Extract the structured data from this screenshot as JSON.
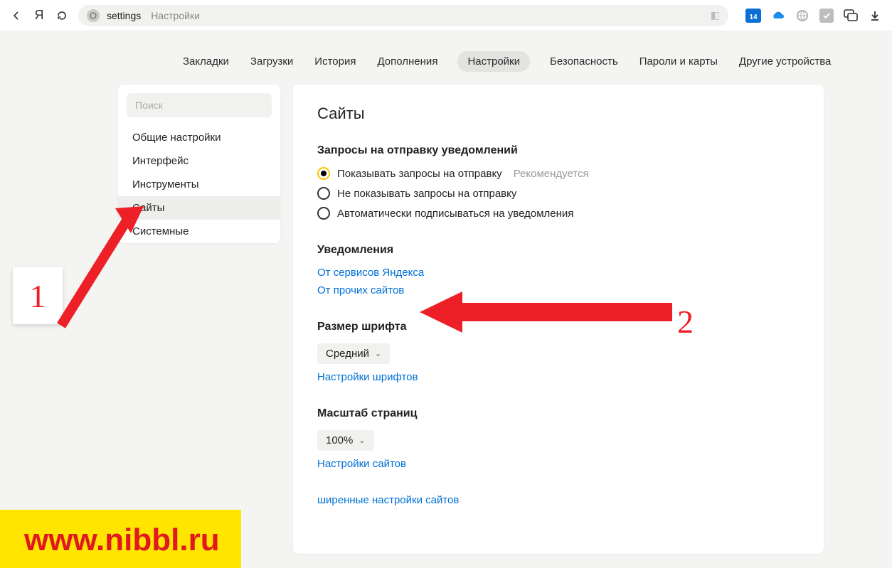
{
  "toolbar": {
    "url_prefix": "settings",
    "url_title": "Настройки",
    "ext_date_badge": "14"
  },
  "tabs": [
    {
      "label": "Закладки"
    },
    {
      "label": "Загрузки"
    },
    {
      "label": "История"
    },
    {
      "label": "Дополнения"
    },
    {
      "label": "Настройки",
      "active": true
    },
    {
      "label": "Безопасность"
    },
    {
      "label": "Пароли и карты"
    },
    {
      "label": "Другие устройства"
    }
  ],
  "sidebar": {
    "search_placeholder": "Поиск",
    "items": [
      {
        "label": "Общие настройки"
      },
      {
        "label": "Интерфейс"
      },
      {
        "label": "Инструменты"
      },
      {
        "label": "Сайты",
        "active": true
      },
      {
        "label": "Системные"
      }
    ]
  },
  "main": {
    "title": "Сайты",
    "notifications_request": {
      "heading": "Запросы на отправку уведомлений",
      "options": [
        {
          "label": "Показывать запросы на отправку",
          "note": "Рекомендуется",
          "checked": true
        },
        {
          "label": "Не показывать запросы на отправку"
        },
        {
          "label": "Автоматически подписываться на уведомления"
        }
      ]
    },
    "notifications": {
      "heading": "Уведомления",
      "links": [
        "От сервисов Яндекса",
        "От прочих сайтов"
      ]
    },
    "font": {
      "heading": "Размер шрифта",
      "value": "Средний",
      "settings_link": "Настройки шрифтов"
    },
    "zoom": {
      "heading": "Масштаб страниц",
      "value": "100%",
      "settings_link": "Настройки сайтов"
    },
    "advanced_hint": "ширенные настройки сайтов"
  },
  "annotations": {
    "num1": "1",
    "num2": "2",
    "watermark": "www.nibbl.ru"
  }
}
